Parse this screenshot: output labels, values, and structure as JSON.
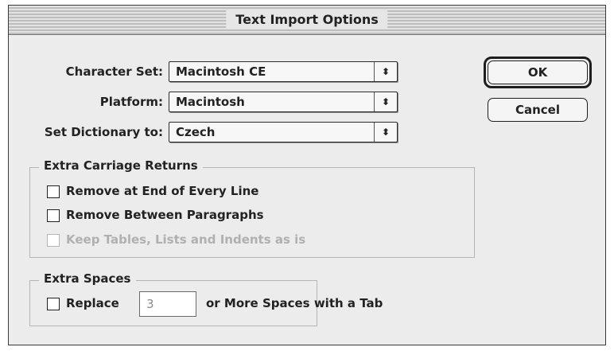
{
  "window": {
    "title": "Text Import Options"
  },
  "fields": [
    {
      "label": "Character Set:",
      "value": "Macintosh CE"
    },
    {
      "label": "Platform:",
      "value": "Macintosh"
    },
    {
      "label": "Set Dictionary to:",
      "value": "Czech"
    }
  ],
  "select_arrow_glyph": "⬍",
  "buttons": {
    "ok": "OK",
    "cancel": "Cancel"
  },
  "extra_carriage_returns": {
    "title": "Extra Carriage Returns",
    "options": [
      {
        "label": "Remove at End of Every Line",
        "checked": false,
        "enabled": true
      },
      {
        "label": "Remove Between Paragraphs",
        "checked": false,
        "enabled": true
      },
      {
        "label": "Keep Tables, Lists and Indents as is",
        "checked": false,
        "enabled": false
      }
    ]
  },
  "extra_spaces": {
    "title": "Extra Spaces",
    "replace_label": "Replace",
    "count": "3",
    "suffix": "or More Spaces with a Tab",
    "checked": false
  }
}
